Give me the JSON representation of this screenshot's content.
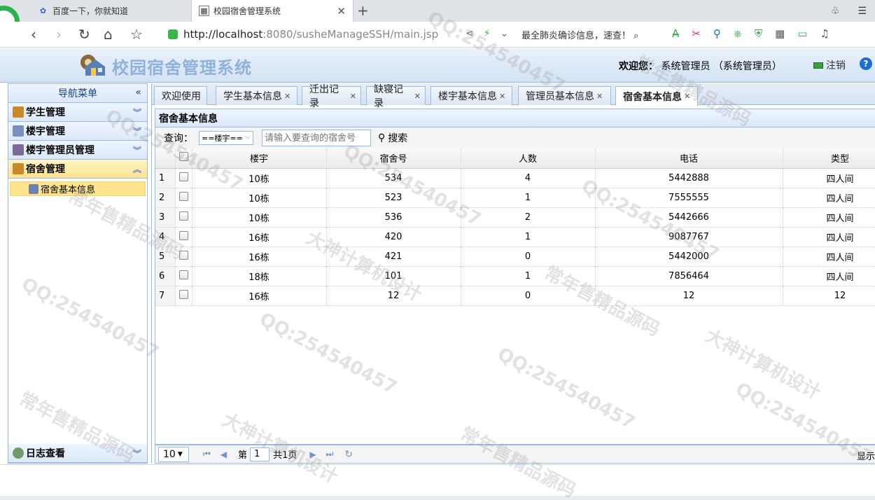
{
  "browser": {
    "tabs": [
      {
        "label": "百度一下，你就知道"
      },
      {
        "label": "校园宿舍管理系统"
      }
    ],
    "url_host": "http://localhost",
    "url_rest": ":8080/susheManageSSH/main.jsp",
    "news_text": "最全肺炎确诊信息，速查！"
  },
  "app": {
    "title": "校园宿舍管理系统",
    "welcome_label": "欢迎您：",
    "welcome_user": "系统管理员 （系统管理员）",
    "logout_label": "注销"
  },
  "nav": {
    "header": "导航菜单",
    "sections": [
      {
        "label": "学生管理",
        "color": "#c9892b"
      },
      {
        "label": "楼宇管理",
        "color": "#7a8fbd"
      },
      {
        "label": "楼宇管理员管理",
        "color": "#7b6a9a"
      },
      {
        "label": "宿舍管理",
        "color": "#c9892b"
      }
    ],
    "active_sub": "宿舍基本信息",
    "log_section": "日志查看"
  },
  "tabs": [
    {
      "label": "欢迎使用"
    },
    {
      "label": "学生基本信息"
    },
    {
      "label": "迁出记录"
    },
    {
      "label": "缺寝记录"
    },
    {
      "label": "楼宇基本信息"
    },
    {
      "label": "管理员基本信息"
    },
    {
      "label": "宿舍基本信息"
    }
  ],
  "panel": {
    "title": "宿舍基本信息",
    "query_label": "查询：",
    "building_select": "==楼宇==",
    "room_placeholder": "请输入要查询的宿舍号",
    "search_label": "搜索"
  },
  "grid": {
    "columns": [
      "楼宇",
      "宿舍号",
      "人数",
      "电话",
      "类型"
    ],
    "rows": [
      [
        "10栋",
        "534",
        "4",
        "5442888",
        "四人间"
      ],
      [
        "10栋",
        "523",
        "1",
        "7555555",
        "四人间"
      ],
      [
        "10栋",
        "536",
        "2",
        "5442666",
        "四人间"
      ],
      [
        "16栋",
        "420",
        "1",
        "9087767",
        "四人间"
      ],
      [
        "16栋",
        "421",
        "0",
        "5442000",
        "四人间"
      ],
      [
        "18栋",
        "101",
        "1",
        "7856464",
        "四人间"
      ],
      [
        "16栋",
        "12",
        "0",
        "12",
        "12"
      ]
    ]
  },
  "pager": {
    "page_size": "10",
    "page_prefix": "第",
    "page_number": "1",
    "page_total": "共1页",
    "display_text": "显示"
  },
  "watermark": [
    "QQ:254540457",
    "大神计算机设计",
    "常年售精品源码"
  ]
}
